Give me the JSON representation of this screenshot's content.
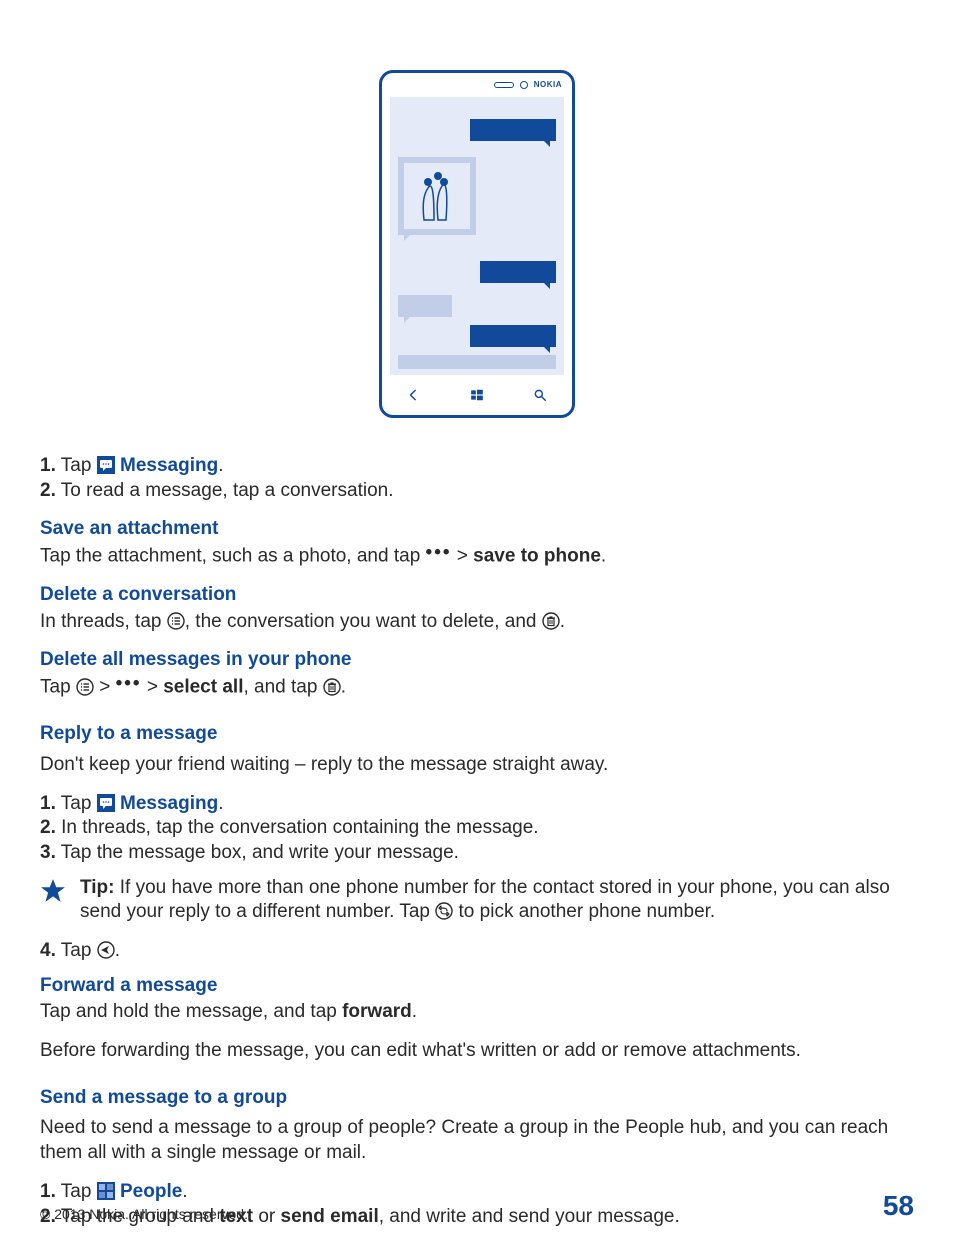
{
  "phone": {
    "brand": "NOKIA"
  },
  "read": {
    "step1_prefix": "1.",
    "step1_tap": " Tap ",
    "step1_link": "Messaging",
    "step1_suffix": ".",
    "step2_prefix": "2.",
    "step2_text": " To read a message, tap a conversation."
  },
  "save_attach": {
    "head": "Save an attachment",
    "text_a": "Tap the attachment, such as a photo, and tap ",
    "gt": " > ",
    "save_bold": "save to phone",
    "end": "."
  },
  "delete_conv": {
    "head": "Delete a conversation",
    "text_a": "In threads, tap ",
    "text_b": ", the conversation you want to delete, and ",
    "end": "."
  },
  "delete_all": {
    "head": "Delete all messages in your phone",
    "text_a": "Tap ",
    "gt1": " > ",
    "gt2": " > ",
    "select_all": "select all",
    "text_b": ", and tap ",
    "end": "."
  },
  "reply": {
    "head": "Reply to a message",
    "intro": "Don't keep your friend waiting – reply to the message straight away.",
    "step1_prefix": "1.",
    "step1_tap": " Tap ",
    "step1_link": "Messaging",
    "step1_suffix": ".",
    "step2_prefix": "2.",
    "step2_text": " In threads, tap the conversation containing the message.",
    "step3_prefix": "3.",
    "step3_text": " Tap the message box, and write your message.",
    "tip_bold": "Tip: ",
    "tip_a": "If you have more than one phone number for the contact stored in your phone, you can also send your reply to a different number. Tap ",
    "tip_b": " to pick another phone number.",
    "step4_prefix": "4.",
    "step4_tap": " Tap ",
    "step4_end": "."
  },
  "forward": {
    "head": "Forward a message",
    "text_a": "Tap and hold the message, and tap ",
    "forward_bold": "forward",
    "end": ".",
    "note": "Before forwarding the message, you can edit what's written or add or remove attachments."
  },
  "group": {
    "head": "Send a message to a group",
    "intro": "Need to send a message to a group of people? Create a group in the People hub, and you can reach them all with a single message or mail.",
    "step1_prefix": "1.",
    "step1_tap": " Tap ",
    "step1_link": "People",
    "step1_suffix": ".",
    "step2_prefix": "2.",
    "step2_a": " Tap the group and ",
    "step2_text": "text",
    "step2_or": " or ",
    "step2_email": "send email",
    "step2_b": ", and write and send your message."
  },
  "footer": {
    "copyright": "© 2013 Nokia. All rights reserved.",
    "page": "58"
  }
}
